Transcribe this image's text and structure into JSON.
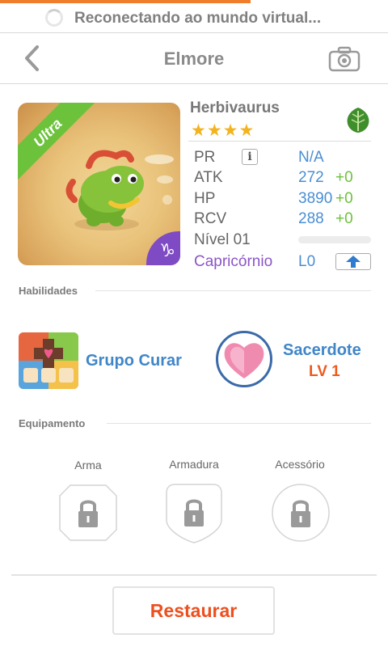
{
  "status": {
    "text": "Reconectando ao mundo virtual..."
  },
  "header": {
    "title": "Elmore",
    "back_icon": "chevron-left-icon",
    "camera_icon": "camera-icon"
  },
  "monster": {
    "rarity_ribbon": "Ultra",
    "zodiac_badge": "♑",
    "name": "Herbivaurus",
    "stars": "★★★★",
    "star_count": 4,
    "element_icon": "leaf-icon",
    "colors": {
      "element": "#3f8e2b",
      "ribbon": "#6cc23a",
      "zodiac": "#7e4bc4"
    }
  },
  "stats": {
    "pr": {
      "label": "PR",
      "value": "N/A",
      "info_icon": "i"
    },
    "atk": {
      "label": "ATK",
      "value": "272",
      "bonus": "+0"
    },
    "hp": {
      "label": "HP",
      "value": "3890",
      "bonus": "+0"
    },
    "rcv": {
      "label": "RCV",
      "value": "288",
      "bonus": "+0"
    },
    "level": {
      "label": "Nível 01",
      "progress": 0
    },
    "zodiac": {
      "label": "Capricórnio",
      "value": "L0",
      "upgrade_icon": "arrow-up-icon"
    }
  },
  "skills": {
    "section_label": "Habilidades",
    "skill": {
      "name": "Grupo Curar"
    },
    "class": {
      "name": "Sacerdote",
      "level": "LV 1",
      "icon": "heart-icon"
    }
  },
  "equipment": {
    "section_label": "Equipamento",
    "slots": [
      {
        "label": "Arma",
        "icon": "lock-icon"
      },
      {
        "label": "Armadura",
        "icon": "lock-icon"
      },
      {
        "label": "Acessório",
        "icon": "lock-icon"
      }
    ]
  },
  "footer": {
    "restore_label": "Restaurar"
  },
  "colors": {
    "accent": "#f07d2c",
    "blue": "#4a8ed3",
    "green": "#6cc23a",
    "purple": "#8c55c8",
    "orange_red": "#ee4f1e"
  }
}
